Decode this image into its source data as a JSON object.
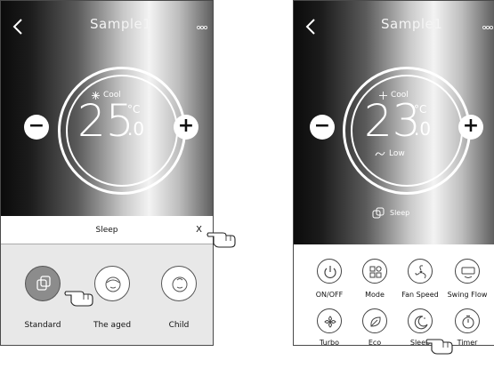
{
  "screen_left": {
    "title": "Sample1",
    "mode": "Cool",
    "temperature": "25",
    "unit": "°C",
    "decimal": ".0",
    "sleep_dialog": {
      "title": "Sleep",
      "close": "X",
      "options": [
        {
          "label": "Standard",
          "selected": true
        },
        {
          "label": "The aged",
          "selected": false
        },
        {
          "label": "Child",
          "selected": false
        }
      ]
    }
  },
  "screen_right": {
    "title": "Sample1",
    "mode": "Cool",
    "temperature": "23",
    "unit": "°C",
    "decimal": ".0",
    "fan_speed": "Low",
    "sleep_status": "Sleep",
    "controls": [
      {
        "label": "ON/OFF",
        "icon": "power-icon"
      },
      {
        "label": "Mode",
        "icon": "mode-grid-icon"
      },
      {
        "label": "Fan Speed",
        "icon": "fan-icon"
      },
      {
        "label": "Swing Flow",
        "icon": "swing-icon"
      },
      {
        "label": "Turbo",
        "icon": "turbo-icon"
      },
      {
        "label": "Eco",
        "icon": "eco-leaf-icon"
      },
      {
        "label": "Sleep",
        "icon": "sleep-moon-icon"
      },
      {
        "label": "Timer",
        "icon": "timer-icon"
      }
    ]
  }
}
